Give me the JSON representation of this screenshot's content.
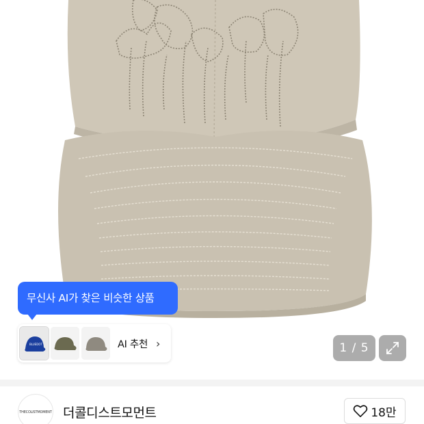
{
  "hero": {
    "image_desc_icon": "beige-cap-photo",
    "cap_color": "#cfc7b7",
    "brim_color": "#c9c1b1",
    "embroidery_color": "#8c8474"
  },
  "ai_recommend": {
    "tooltip_text": "무신사 AI가 찾은 비슷한 상품",
    "tooltip_color": "#2f6bff",
    "strip_label": "AI 추천",
    "thumb_logo_text": "BLUEDOT",
    "thumbnails": [
      {
        "icon": "blue-cap-thumbnail",
        "color": "#1b3f9e"
      },
      {
        "icon": "olive-cap-thumbnail",
        "color": "#6b6a50"
      },
      {
        "icon": "gray-cap-thumbnail",
        "color": "#8f8a80"
      }
    ]
  },
  "gallery": {
    "counter": "1 / 5"
  },
  "shop": {
    "logo_text": "THECOLISTMOMENT",
    "name": "더콜디스트모먼트",
    "likes": "18만"
  }
}
